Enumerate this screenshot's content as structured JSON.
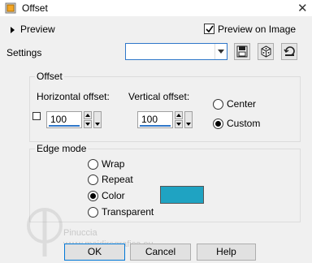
{
  "window": {
    "title": "Offset",
    "close_glyph": "✕"
  },
  "header": {
    "preview_toggle": "Preview",
    "preview_on_image": {
      "label": "Preview on Image",
      "checked": true
    }
  },
  "settings": {
    "label": "Settings",
    "value": ""
  },
  "offset_group": {
    "title": "Offset",
    "horizontal_label": "Horizontal offset:",
    "vertical_label": "Vertical offset:",
    "horizontal_value": "100",
    "vertical_value": "100",
    "link_checked": false,
    "center_label": "Center",
    "custom_label": "Custom",
    "selected": "Custom"
  },
  "edge_group": {
    "title": "Edge mode",
    "options": [
      "Wrap",
      "Repeat",
      "Color",
      "Transparent"
    ],
    "selected": "Color",
    "color": "#1fa3c2"
  },
  "buttons": {
    "ok": "OK",
    "cancel": "Cancel",
    "help": "Help"
  },
  "watermark": {
    "line1": "Pinuccia",
    "line2": "www.maidiregrafica.eu"
  }
}
